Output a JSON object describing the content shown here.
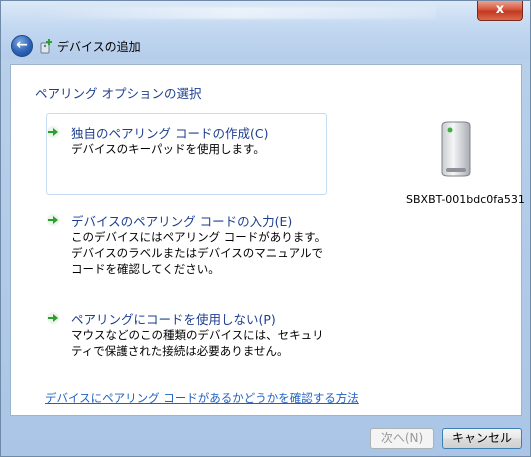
{
  "window": {
    "title": "デバイスの追加",
    "close_label": "x"
  },
  "main": {
    "heading": "ペアリング オプションの選択",
    "options": [
      {
        "title": "独自のペアリング コードの作成(C)",
        "description": "デバイスのキーパッドを使用します。"
      },
      {
        "title": "デバイスのペアリング コードの入力(E)",
        "description": "このデバイスにはペアリング コードがあります。デバイスのラベルまたはデバイスのマニュアルでコードを確認してください。"
      },
      {
        "title": "ペアリングにコードを使用しない(P)",
        "description": "マウスなどのこの種類のデバイスには、セキュリティで保護された接続は必要ありません。"
      }
    ],
    "device_name": "SBXBT-001bdc0fa531",
    "help_link": "デバイスにペアリング コードがあるかどうかを確認する方法"
  },
  "footer": {
    "next_label": "次へ(N)",
    "cancel_label": "キャンセル"
  },
  "colors": {
    "heading": "#1e3f8f",
    "link": "#2062c2",
    "arrow": "#2e9e2e"
  }
}
